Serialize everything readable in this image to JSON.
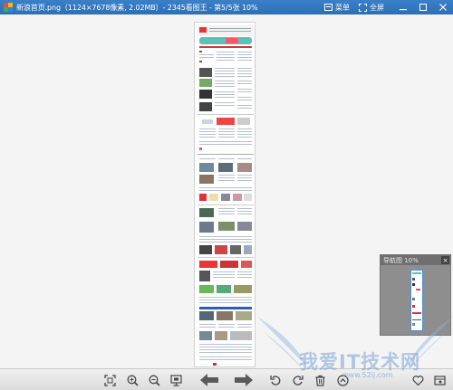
{
  "window": {
    "title": "新浪首页.png（1124×7678像素, 2.02MB）- 2345看图王 - 第5/5张 10%",
    "menu_label": "菜单",
    "fullscreen_label": "全屏"
  },
  "navigator": {
    "title": "导航图 10%",
    "close": "×"
  },
  "toolbar": {
    "items": [
      "fit-screen-icon",
      "zoom-in-icon",
      "zoom-out-icon",
      "actual-size-icon",
      "previous-icon",
      "next-icon",
      "rotate-left-icon",
      "rotate-right-icon",
      "delete-icon",
      "slideshow-icon",
      "favorite-icon",
      "more-icon"
    ]
  },
  "watermark": {
    "text": "我爱IT技术网",
    "url": "www.52ij.com"
  }
}
